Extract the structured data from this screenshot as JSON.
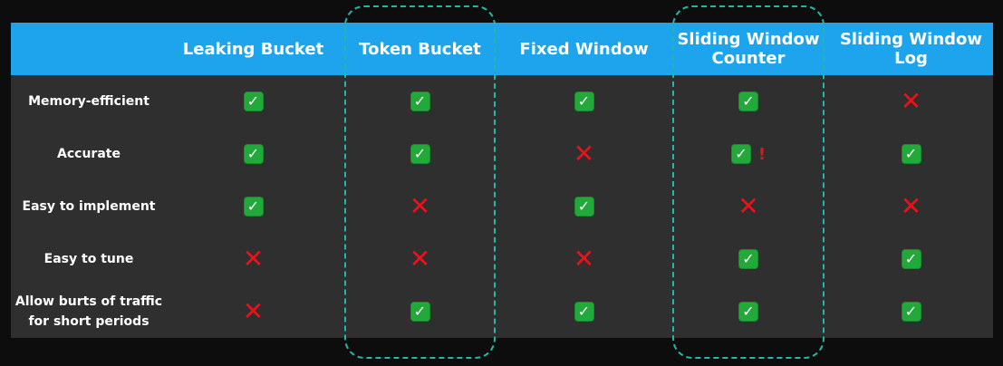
{
  "columns": [
    {
      "label": "Leaking Bucket"
    },
    {
      "label": "Token Bucket"
    },
    {
      "label": "Fixed Window"
    },
    {
      "label": "Sliding Window\nCounter"
    },
    {
      "label": "Sliding Window\nLog"
    }
  ],
  "rows": [
    {
      "label": "Memory-efficient",
      "values": [
        "check",
        "check",
        "check",
        "check",
        "cross"
      ]
    },
    {
      "label": "Accurate",
      "values": [
        "check",
        "check",
        "cross",
        "check-warning",
        "check"
      ]
    },
    {
      "label": "Easy to implement",
      "values": [
        "check",
        "cross",
        "check",
        "cross",
        "cross"
      ]
    },
    {
      "label": "Easy to tune",
      "values": [
        "cross",
        "cross",
        "cross",
        "check",
        "check"
      ]
    },
    {
      "label": "Allow burts of traffic\nfor short periods",
      "values": [
        "cross",
        "check",
        "check",
        "check",
        "check"
      ]
    }
  ],
  "symbols": {
    "check": "✓",
    "cross": "✕",
    "warning": "!"
  },
  "colors": {
    "header_bg": "#1ea4ec",
    "table_bg": "#2f2f2f",
    "check_green": "#23a83a",
    "cross_red": "#e8131a",
    "highlight": "#22b7a9"
  },
  "highlighted_columns": [
    "Token Bucket",
    "Sliding Window\nCounter"
  ]
}
